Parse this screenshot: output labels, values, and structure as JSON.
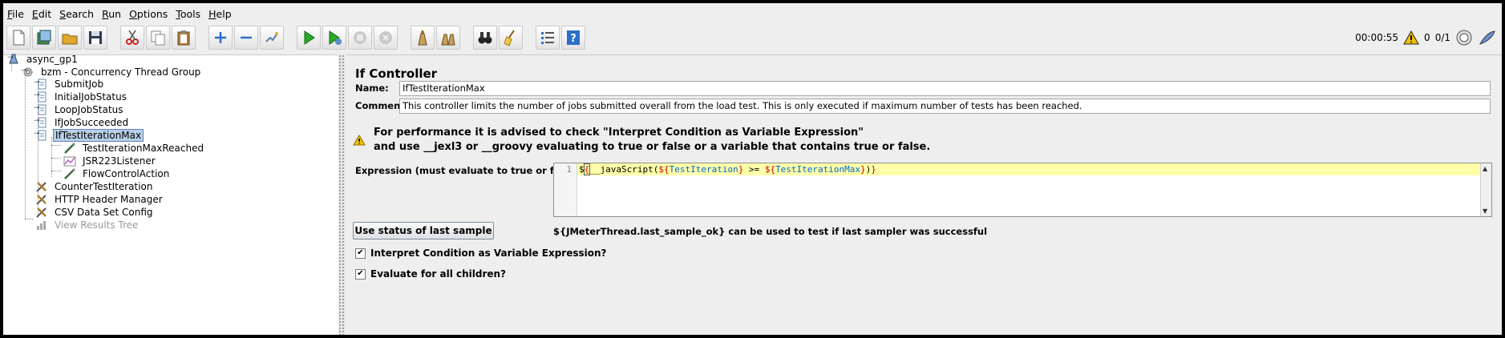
{
  "menu": [
    "File",
    "Edit",
    "Search",
    "Run",
    "Options",
    "Tools",
    "Help"
  ],
  "menu_mnemonics": [
    "F",
    "E",
    "S",
    "R",
    "O",
    "T",
    "H"
  ],
  "toolbar": {
    "timer": "00:00:55",
    "warnings": "0",
    "threads": "0/1",
    "buttons": [
      "new-icon",
      "templates-icon",
      "open-icon",
      "save-icon",
      "cut-icon",
      "copy-icon",
      "paste-icon",
      "expand-icon",
      "collapse-icon",
      "toggle-icon",
      "start-icon",
      "start-no-pauses-icon",
      "stop-icon",
      "shutdown-icon",
      "clear-icon",
      "clear-all-icon",
      "search-icon",
      "reset-search-icon",
      "function-helper-icon",
      "help-icon"
    ]
  },
  "tree": {
    "root": "async_gp1",
    "thread_group": "bzm - Concurrency Thread Group",
    "items": [
      {
        "label": "SubmitJob",
        "icon": "controller-icon"
      },
      {
        "label": "InitialJobStatus",
        "icon": "controller-icon"
      },
      {
        "label": "LoopJobStatus",
        "icon": "controller-icon"
      },
      {
        "label": "IfJobSucceeded",
        "icon": "controller-icon"
      },
      {
        "label": "IfTestIterationMax",
        "icon": "controller-icon",
        "selected": true
      },
      {
        "label": "TestIterationMaxReached",
        "icon": "sampler-icon"
      },
      {
        "label": "JSR223Listener",
        "icon": "listener-icon"
      },
      {
        "label": "FlowControlAction",
        "icon": "sampler-icon"
      },
      {
        "label": "CounterTestIteration",
        "icon": "config-icon"
      },
      {
        "label": "HTTP Header Manager",
        "icon": "config-icon"
      },
      {
        "label": "CSV Data Set Config",
        "icon": "config-icon"
      },
      {
        "label": "View Results Tree",
        "icon": "results-icon",
        "disabled": true
      }
    ]
  },
  "panel": {
    "title": "If Controller",
    "name_label": "Name:",
    "name_value": "IfTestIterationMax",
    "comments_label": "Comments:",
    "comments_value": "This controller limits the number of jobs submitted overall from the load test. This is only executed if maximum number of tests has been reached.",
    "warning_line1": "For performance it is advised to check \"Interpret Condition as Variable Expression\"",
    "warning_line2": "and use __jexl3 or __groovy evaluating to true or false or a variable that contains true or false.",
    "expression_label": "Expression (must evaluate to true or false)",
    "line_number": "1",
    "expr": {
      "p1": "$",
      "b1": "{",
      "p2": "__javaScript(",
      "b2": "$",
      "b3": "{",
      "v1": "TestIteration",
      "b4": "}",
      "p3": " >= ",
      "b5": "$",
      "b6": "{",
      "v2": "TestIterationMax",
      "b7": "}",
      "p4": ")",
      "b8": "}"
    },
    "use_status_button": "Use status of last sample",
    "last_sample_hint": "${JMeterThread.last_sample_ok} can be used to test if last sampler was successful",
    "interpret_label": "Interpret Condition as Variable Expression?",
    "interpret_checked": true,
    "evaluate_all_label": "Evaluate for all children?",
    "evaluate_all_checked": true
  },
  "colors": {
    "selection": "#b8cfe5",
    "code_highlight": "#ffffaa",
    "warning": "#f2c200"
  }
}
